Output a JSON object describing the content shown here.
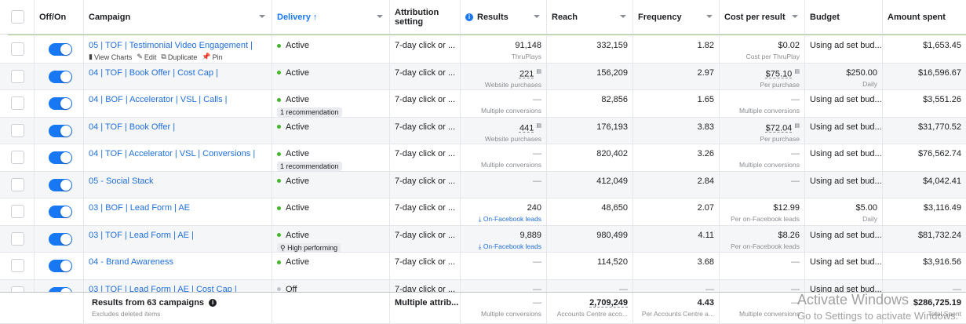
{
  "header": {
    "offon": "Off/On",
    "campaign": "Campaign",
    "delivery": "Delivery ↑",
    "attribution": "Attribution setting",
    "results": "Results",
    "reach": "Reach",
    "frequency": "Frequency",
    "cost_per_result": "Cost per result",
    "budget": "Budget",
    "amount_spent": "Amount spent"
  },
  "row_actions": {
    "view_charts": "View Charts",
    "edit": "Edit",
    "duplicate": "Duplicate",
    "pin": "Pin"
  },
  "rows": [
    {
      "campaign": "05 | TOF | Testimonial Video Engagement |",
      "delivery": "Active",
      "chip": "",
      "attribution": "7-day click or ...",
      "results": "91,148",
      "results_sub": "ThruPlays",
      "reach": "332,159",
      "frequency": "1.82",
      "cpr": "$0.02",
      "cpr_sub": "Cost per ThruPlay",
      "budget": "Using ad set bud...",
      "budget_sub": "",
      "spent": "$1,653.45"
    },
    {
      "campaign": "04 | TOF | Book Offer | Cost Cap |",
      "delivery": "Active",
      "chip": "",
      "attribution": "7-day click or ...",
      "results": "221",
      "results_sub": "Website purchases",
      "reach": "156,209",
      "frequency": "2.97",
      "cpr": "$75.10",
      "cpr_sub": "Per purchase",
      "budget": "$250.00",
      "budget_sub": "Daily",
      "spent": "$16,596.67"
    },
    {
      "campaign": "04 | BOF | Accelerator | VSL | Calls |",
      "delivery": "Active",
      "chip": "1 recommendation",
      "attribution": "7-day click or ...",
      "results": "—",
      "results_sub": "Multiple conversions",
      "reach": "82,856",
      "frequency": "1.65",
      "cpr": "—",
      "cpr_sub": "Multiple conversions",
      "budget": "Using ad set bud...",
      "budget_sub": "",
      "spent": "$3,551.26"
    },
    {
      "campaign": "04 | TOF | Book Offer |",
      "delivery": "Active",
      "chip": "",
      "attribution": "7-day click or ...",
      "results": "441",
      "results_sub": "Website purchases",
      "reach": "176,193",
      "frequency": "3.83",
      "cpr": "$72.04",
      "cpr_sub": "Per purchase",
      "budget": "Using ad set bud...",
      "budget_sub": "",
      "spent": "$31,770.52"
    },
    {
      "campaign": "04 | TOF | Accelerator | VSL | Conversions |",
      "delivery": "Active",
      "chip": "1 recommendation",
      "attribution": "7-day click or ...",
      "results": "—",
      "results_sub": "Multiple conversions",
      "reach": "820,402",
      "frequency": "3.26",
      "cpr": "—",
      "cpr_sub": "Multiple conversions",
      "budget": "Using ad set bud...",
      "budget_sub": "",
      "spent": "$76,562.74"
    },
    {
      "campaign": "05 - Social Stack",
      "delivery": "Active",
      "chip": "",
      "attribution": "7-day click or ...",
      "results": "—",
      "results_sub": "",
      "reach": "412,049",
      "frequency": "2.84",
      "cpr": "—",
      "cpr_sub": "",
      "budget": "Using ad set bud...",
      "budget_sub": "",
      "spent": "$4,042.41"
    },
    {
      "campaign": "03 | BOF | Lead Form | AE",
      "delivery": "Active",
      "chip": "",
      "attribution": "7-day click or ...",
      "results": "240",
      "results_sub": "On-Facebook leads",
      "reach": "48,650",
      "frequency": "2.07",
      "cpr": "$12.99",
      "cpr_sub": "Per on-Facebook leads",
      "budget": "$5.00",
      "budget_sub": "Daily",
      "spent": "$3,116.49"
    },
    {
      "campaign": "03 | TOF | Lead Form | AE |",
      "delivery": "Active",
      "chip": "High performing",
      "attribution": "7-day click or ...",
      "results": "9,889",
      "results_sub": "On-Facebook leads",
      "reach": "980,499",
      "frequency": "4.11",
      "cpr": "$8.26",
      "cpr_sub": "Per on-Facebook leads",
      "budget": "Using ad set bud...",
      "budget_sub": "",
      "spent": "$81,732.24"
    },
    {
      "campaign": "04 - Brand Awareness",
      "delivery": "Active",
      "chip": "",
      "attribution": "7-day click or ...",
      "results": "—",
      "results_sub": "",
      "reach": "114,520",
      "frequency": "3.68",
      "cpr": "—",
      "cpr_sub": "",
      "budget": "Using ad set bud...",
      "budget_sub": "",
      "spent": "$3,916.56"
    },
    {
      "campaign": "03 | TOF | Lead Form | AE | Cost Cap |",
      "delivery": "Off",
      "chip": "",
      "attribution": "7-day click or ...",
      "results": "—",
      "results_sub": "",
      "reach": "—",
      "frequency": "—",
      "cpr": "—",
      "cpr_sub": "",
      "budget": "Using ad set bud...",
      "budget_sub": "",
      "spent": "—"
    }
  ],
  "footer": {
    "title": "Results from 63 campaigns",
    "sub": "Excludes deleted items",
    "attribution": "Multiple attrib...",
    "results": "—",
    "results_sub": "Multiple conversions",
    "reach": "2,709,249",
    "reach_sub": "Accounts Centre acco...",
    "frequency": "4.43",
    "frequency_sub": "Per Accounts Centre a...",
    "cpr": "—",
    "cpr_sub": "Multiple conversions",
    "spent": "$286,725.19",
    "spent_sub": "Total Spent"
  },
  "watermark": {
    "line1": "Activate Windows",
    "line2": "Go to Settings to activate Windows."
  },
  "colors": {
    "accent": "#1877f2",
    "link": "#216fdb",
    "active_dot": "#42b72a"
  }
}
